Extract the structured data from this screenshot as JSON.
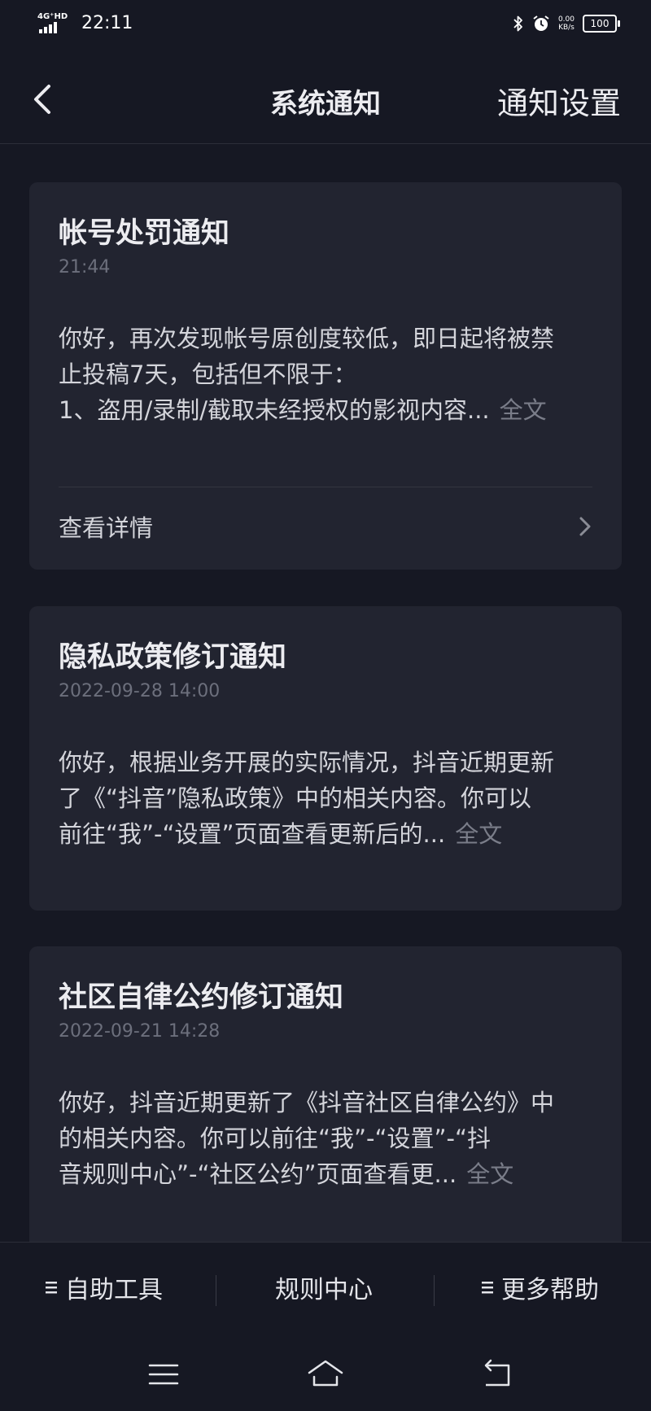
{
  "status_bar": {
    "network": "4G⁺HD",
    "time": "22:11",
    "speed_value": "0.00",
    "speed_unit": "KB/s",
    "battery": "100"
  },
  "header": {
    "title": "系统通知",
    "settings_label": "通知设置"
  },
  "notifications": [
    {
      "title": "帐号处罚通知",
      "time": "21:44",
      "line1": "你好，再次发现帐号原创度较低，即日起将被禁",
      "line2": "止投稿7天，包括但不限于：",
      "line3": "1、盗用/录制/截取未经授权的影视内容...",
      "fulltext": "全文",
      "detail_label": "查看详情"
    },
    {
      "title": "隐私政策修订通知",
      "time": "2022-09-28  14:00",
      "line1": "你好，根据业务开展的实际情况，抖音近期更新",
      "line2": "了《“抖音”隐私政策》中的相关内容。你可以",
      "line3": "前往“我”-“设置”页面查看更新后的...",
      "fulltext": "全文"
    },
    {
      "title": "社区自律公约修订通知",
      "time": "2022-09-21  14:28",
      "line1": "你好，抖音近期更新了《抖音社区自律公约》中",
      "line2": "的相关内容。你可以前往“我”-“设置”-“抖",
      "line3": "音规则中心”-“社区公约”页面查看更...",
      "fulltext": "全文"
    }
  ],
  "bottom_bar": {
    "tools_label": "自助工具",
    "rules_label": "规则中心",
    "help_label": "更多帮助"
  },
  "icons": {
    "back": "chevron-left-icon",
    "detail": "chevron-right-icon",
    "menu": "menu-lines-icon",
    "sys_menu": "hamburger-icon",
    "sys_home": "home-icon",
    "sys_back": "return-icon"
  }
}
